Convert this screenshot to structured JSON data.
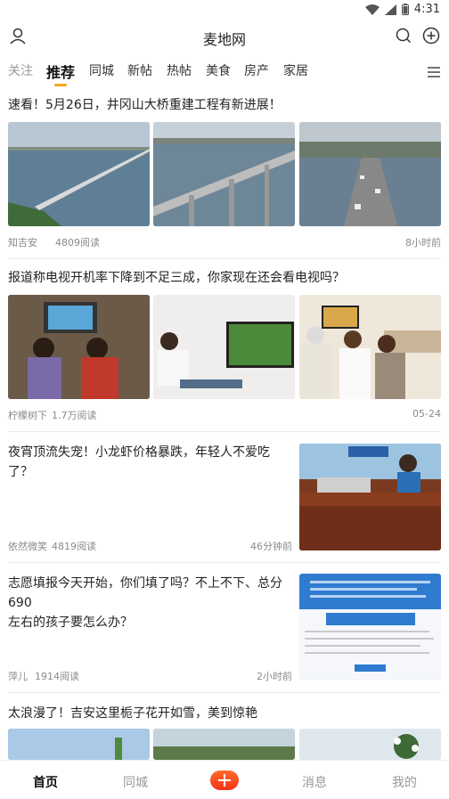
{
  "status": {
    "time": "4:31"
  },
  "header": {
    "title": "麦地网"
  },
  "tabs": [
    {
      "label": "关注"
    },
    {
      "label": "推荐"
    },
    {
      "label": "同城"
    },
    {
      "label": "新帖"
    },
    {
      "label": "热帖"
    },
    {
      "label": "美食"
    },
    {
      "label": "房产"
    },
    {
      "label": "家居"
    }
  ],
  "articles": [
    {
      "title": "速看！5月26日，井冈山大桥重建工程有新进展！",
      "author": "知吉安",
      "reads": "4809阅读",
      "time": "8小时前"
    },
    {
      "title": "报道称电视开机率下降到不足三成，你家现在还会看电视吗？",
      "author": "柠檬树下",
      "reads": "1.7万阅读",
      "time": "05-24"
    },
    {
      "title": "夜宵顶流失宠！小龙虾价格暴跌，年轻人不爱吃了？",
      "author": "依然微笑",
      "reads": "4819阅读",
      "time": "46分钟前"
    },
    {
      "title_line1": "志愿填报今天开始，你们填了吗？不上不下、总分690",
      "title_line2": "左右的孩子要怎么办？",
      "author": "萍儿",
      "reads": "1914阅读",
      "time": "2小时前"
    },
    {
      "title": "太浪漫了！吉安这里栀子花开如雪，美到惊艳"
    }
  ],
  "bottom_nav": [
    {
      "label": "首页"
    },
    {
      "label": "同城"
    },
    {
      "label": "消息"
    },
    {
      "label": "我的"
    }
  ]
}
